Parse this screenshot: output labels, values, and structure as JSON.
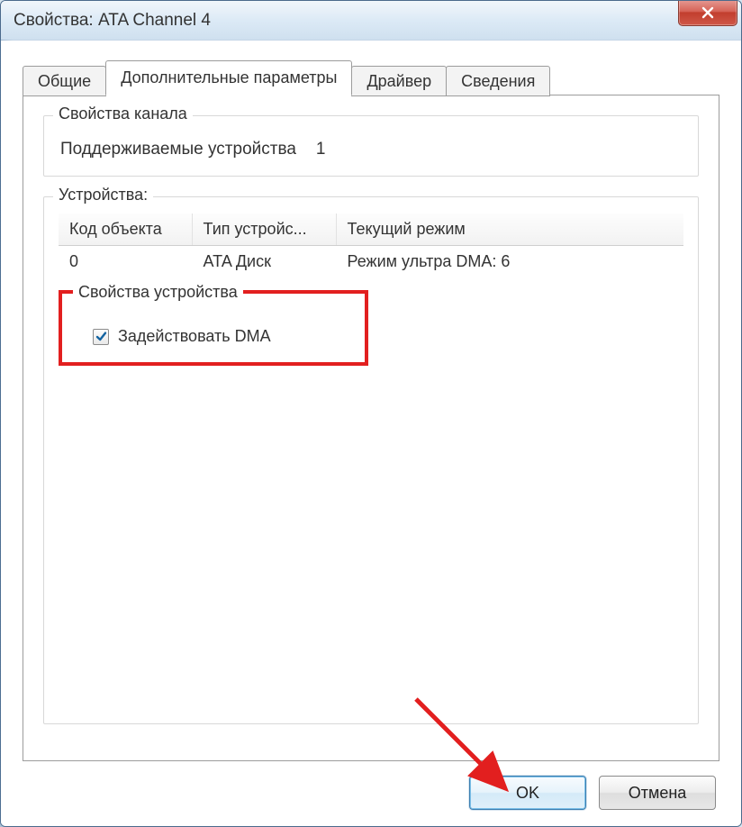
{
  "window": {
    "title": "Свойства: ATA Channel 4"
  },
  "tabs": {
    "general": "Общие",
    "advanced": "Дополнительные параметры",
    "driver": "Драйвер",
    "details": "Сведения"
  },
  "channel_props": {
    "legend": "Свойства канала",
    "supported_label": "Поддерживаемые устройства",
    "supported_count": "1"
  },
  "devices": {
    "legend": "Устройства:",
    "columns": {
      "id": "Код объекта",
      "type": "Тип устройс...",
      "mode": "Текущий режим"
    },
    "rows": [
      {
        "id": "0",
        "type": "ATA Диск",
        "mode": "Режим ультра DMA: 6"
      }
    ]
  },
  "device_props": {
    "legend": "Свойства устройства",
    "enable_dma": "Задействовать DMA",
    "checked": true
  },
  "buttons": {
    "ok": "OK",
    "cancel": "Отмена"
  }
}
